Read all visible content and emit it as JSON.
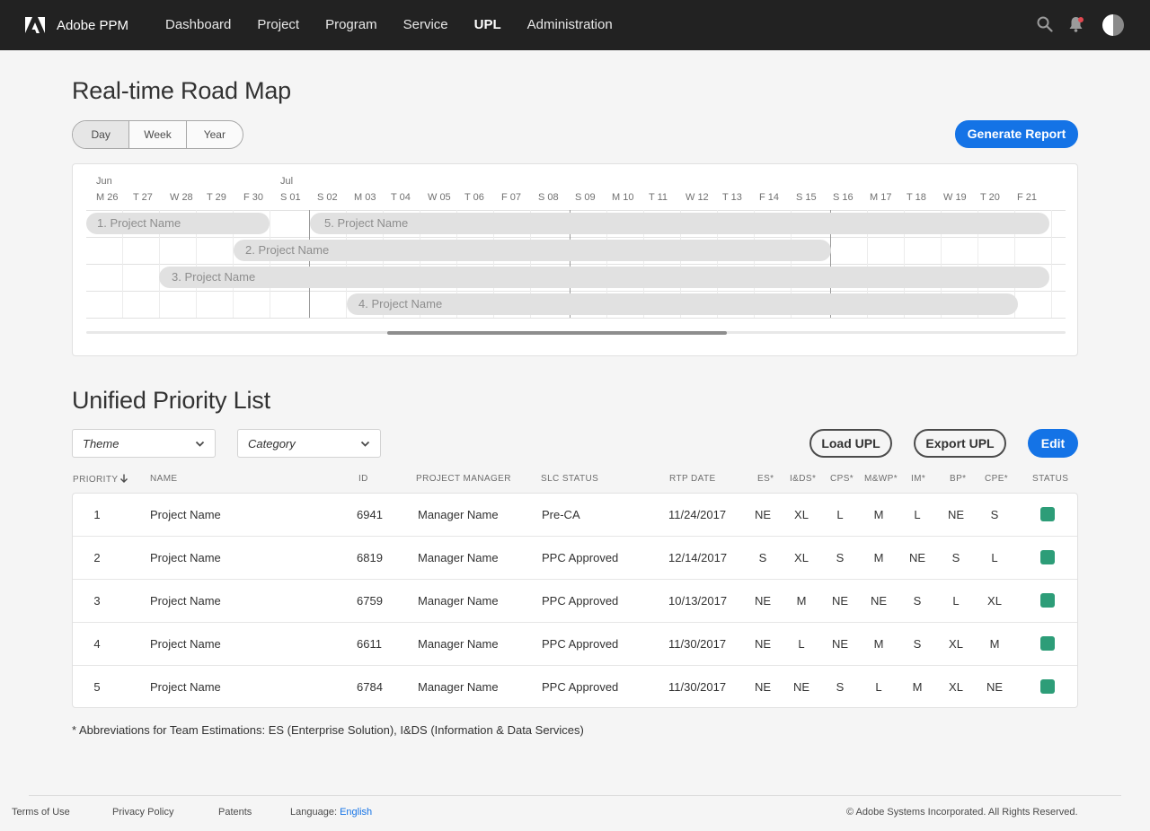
{
  "header": {
    "app_title": "Adobe PPM",
    "nav": [
      "Dashboard",
      "Project",
      "Program",
      "Service",
      "UPL",
      "Administration"
    ],
    "active_nav": "UPL",
    "notification_color": "#e34850"
  },
  "roadmap": {
    "title": "Real-time Road Map",
    "view_options": [
      "Day",
      "Week",
      "Year"
    ],
    "selected_view": "Day",
    "generate_button": "Generate Report",
    "months": [
      "Jun",
      "Jul"
    ],
    "days": [
      "M 26",
      "T 27",
      "W 28",
      "T 29",
      "F 30",
      "S 01",
      "S 02",
      "M 03",
      "T 04",
      "W 05",
      "T 06",
      "F 07",
      "S 08",
      "S 09",
      "M 10",
      "T 11",
      "W 12",
      "T 13",
      "F 14",
      "S 15",
      "S 16",
      "M 17",
      "T 18",
      "W 19",
      "T 20",
      "F 21"
    ],
    "projects": [
      "1. Project Name",
      "2. Project Name",
      "3. Project Name",
      "4. Project Name",
      "5. Project Name"
    ]
  },
  "upl": {
    "title": "Unified Priority List",
    "theme_placeholder": "Theme",
    "category_placeholder": "Category",
    "load_button": "Load UPL",
    "export_button": "Export UPL",
    "edit_button": "Edit",
    "columns": [
      "PRIORITY",
      "NAME",
      "ID",
      "PROJECT MANAGER",
      "SLC STATUS",
      "RTP DATE",
      "ES*",
      "I&DS*",
      "CPS*",
      "M&WP*",
      "IM*",
      "BP*",
      "CPE*",
      "STATUS"
    ],
    "rows": [
      {
        "priority": "1",
        "name": "Project Name",
        "id": "6941",
        "manager": "Manager Name",
        "slc": "Pre-CA",
        "rtp": "11/24/2017",
        "es": "NE",
        "ids": "XL",
        "cps": "L",
        "mwp": "M",
        "im": "L",
        "bp": "NE",
        "cpe": "S"
      },
      {
        "priority": "2",
        "name": "Project Name",
        "id": "6819",
        "manager": "Manager Name",
        "slc": "PPC Approved",
        "rtp": "12/14/2017",
        "es": "S",
        "ids": "XL",
        "cps": "S",
        "mwp": "M",
        "im": "NE",
        "bp": "S",
        "cpe": "L"
      },
      {
        "priority": "3",
        "name": "Project Name",
        "id": "6759",
        "manager": "Manager Name",
        "slc": "PPC Approved",
        "rtp": "10/13/2017",
        "es": "NE",
        "ids": "M",
        "cps": "NE",
        "mwp": "NE",
        "im": "S",
        "bp": "L",
        "cpe": "XL"
      },
      {
        "priority": "4",
        "name": "Project Name",
        "id": "6611",
        "manager": "Manager Name",
        "slc": "PPC Approved",
        "rtp": "11/30/2017",
        "es": "NE",
        "ids": "L",
        "cps": "NE",
        "mwp": "M",
        "im": "S",
        "bp": "XL",
        "cpe": "M"
      },
      {
        "priority": "5",
        "name": "Project Name",
        "id": "6784",
        "manager": "Manager Name",
        "slc": "PPC Approved",
        "rtp": "11/30/2017",
        "es": "NE",
        "ids": "NE",
        "cps": "S",
        "mwp": "L",
        "im": "M",
        "bp": "XL",
        "cpe": "NE"
      }
    ],
    "status_color": "#2d9d78",
    "footnote": "* Abbreviations for Team Estimations: ES (Enterprise Solution), I&DS (Information & Data Services)"
  },
  "footer": {
    "terms": "Terms of Use",
    "privacy": "Privacy Policy",
    "patents": "Patents",
    "language_label": "Language:",
    "language_value": "English",
    "copyright": "© Adobe Systems Incorporated. All Rights Reserved."
  },
  "colors": {
    "accent": "#1473e6",
    "topbar": "#222222"
  }
}
